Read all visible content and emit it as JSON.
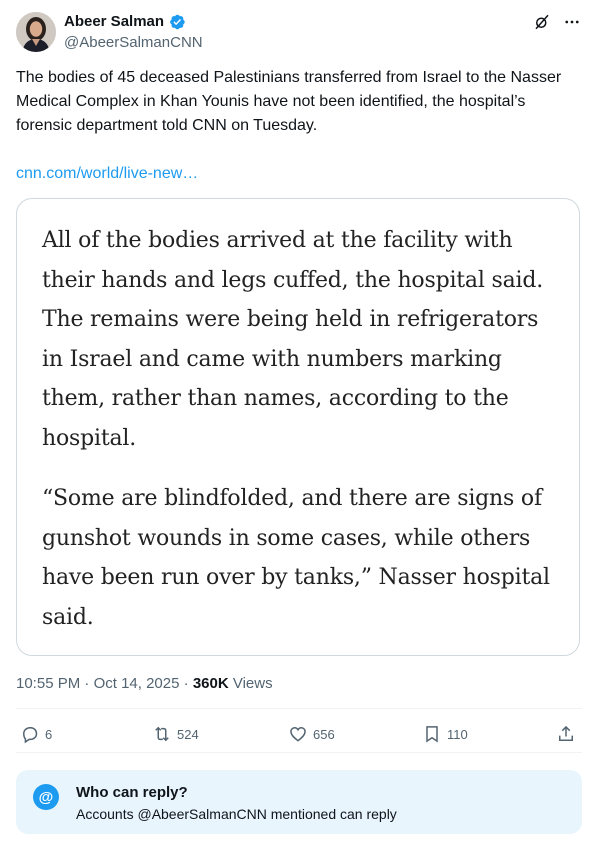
{
  "author": {
    "name": "Abeer Salman",
    "handle": "@AbeerSalmanCNN",
    "verified": true,
    "verified_color": "#1d9bf0"
  },
  "tweet": {
    "text": "The bodies of 45 deceased Palestinians transferred from Israel to the Nasser Medical Complex in Khan Younis have not been identified, the hospital’s forensic department told CNN on Tuesday.",
    "link": "cnn.com/world/live-new…"
  },
  "quote_card": {
    "paragraphs": [
      "All of the bodies arrived at the facility with their hands and legs cuffed, the hospital said. The remains were being held in refrigerators in Israel and came with numbers marking them, rather than names, according to the hospital.",
      "“Some are blindfolded, and there are signs of gunshot wounds in some cases, while others have been run over by tanks,” Nasser hospital said."
    ]
  },
  "meta": {
    "time": "10:55 PM",
    "separator": "·",
    "date": "Oct 14, 2025",
    "views_count": "360K",
    "views_label": "Views"
  },
  "actions": {
    "replies": "6",
    "reposts": "524",
    "likes": "656",
    "bookmarks": "110"
  },
  "who_can_reply": {
    "badge": "@",
    "title": "Who can reply?",
    "subtitle": "Accounts @AbeerSalmanCNN mentioned can reply"
  },
  "icons": [
    "verified-badge-icon",
    "grok-icon",
    "more-icon",
    "reply-icon",
    "repost-icon",
    "like-icon",
    "bookmark-icon",
    "share-icon"
  ],
  "colors": {
    "accent": "#1d9bf0",
    "secondary_text": "#536471",
    "reply_box_bg": "#e8f5fd"
  }
}
